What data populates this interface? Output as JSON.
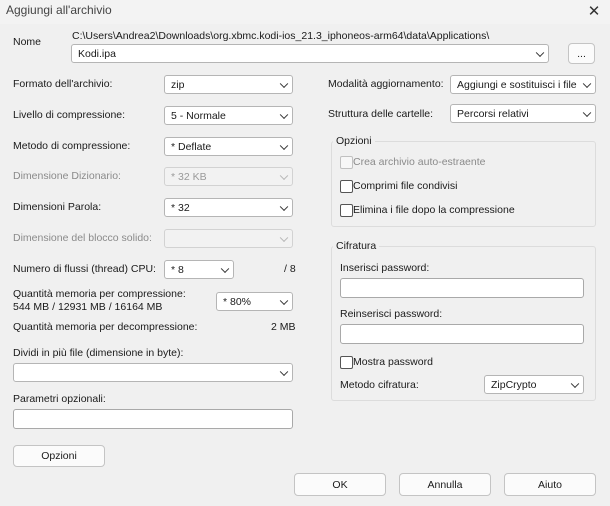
{
  "window": {
    "title": "Aggiungi all'archivio",
    "close": "✕"
  },
  "name": {
    "label": "Nome",
    "path": "C:\\Users\\Andrea2\\Downloads\\org.xbmc.kodi-ios_21.3_iphoneos-arm64\\data\\Applications\\",
    "value": "Kodi.ipa",
    "browse_label": "..."
  },
  "left": {
    "format": {
      "label": "Formato dell'archivio:",
      "value": "zip"
    },
    "level": {
      "label": "Livello di compressione:",
      "value": "5 - Normale"
    },
    "method": {
      "label": "Metodo di compressione:",
      "value": "*  Deflate"
    },
    "dict": {
      "label": "Dimensione Dizionario:",
      "value": "*  32 KB"
    },
    "word": {
      "label": "Dimensioni Parola:",
      "value": "*  32"
    },
    "solid": {
      "label": "Dimensione del blocco solido:",
      "value": ""
    },
    "threads": {
      "label": "Numero di flussi (thread) CPU:",
      "value": "*  8",
      "max": "/ 8"
    },
    "mem_comp": {
      "label": "Quantità memoria per compressione:",
      "detail": "544 MB / 12931 MB / 16164 MB",
      "value": "*  80%"
    },
    "mem_decomp": {
      "label": "Quantità memoria per decompressione:",
      "value": "2 MB"
    },
    "split": {
      "label": "Dividi in più file (dimensione in byte):",
      "value": ""
    },
    "params": {
      "label": "Parametri opzionali:",
      "value": ""
    },
    "options_button": "Opzioni"
  },
  "right": {
    "update": {
      "label": "Modalità aggiornamento:",
      "value": "Aggiungi e sostituisci i file"
    },
    "paths": {
      "label": "Struttura delle cartelle:",
      "value": "Percorsi relativi"
    },
    "options_group": {
      "title": "Opzioni",
      "sfx": "Crea archivio auto-estraente",
      "shared": "Comprimi file condivisi",
      "delete": "Elimina i file dopo la compressione"
    },
    "encryption": {
      "title": "Cifratura",
      "pw_label": "Inserisci password:",
      "pw_value": "",
      "pw2_label": "Reinserisci password:",
      "pw2_value": "",
      "show_pw": "Mostra password",
      "method_label": "Metodo cifratura:",
      "method_value": "ZipCrypto"
    }
  },
  "footer": {
    "ok": "OK",
    "cancel": "Annulla",
    "help": "Aiuto"
  }
}
